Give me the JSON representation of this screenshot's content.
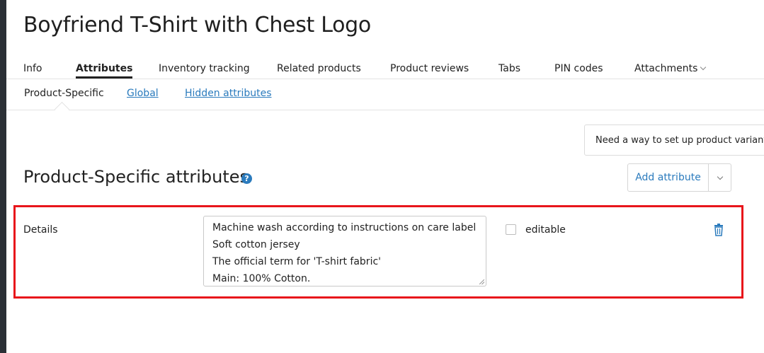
{
  "product": {
    "title": "Boyfriend T-Shirt with Chest Logo"
  },
  "tabs": [
    {
      "label": "Info"
    },
    {
      "label": "Attributes"
    },
    {
      "label": "Inventory tracking"
    },
    {
      "label": "Related products"
    },
    {
      "label": "Product reviews"
    },
    {
      "label": "Tabs"
    },
    {
      "label": "PIN codes"
    },
    {
      "label": "Attachments"
    }
  ],
  "subtabs": [
    {
      "label": "Product-Specific"
    },
    {
      "label": "Global"
    },
    {
      "label": "Hidden attributes"
    }
  ],
  "hint": {
    "text": "Need a way to set up product variants?"
  },
  "section": {
    "title": "Product-Specific attributes",
    "help_icon": "?",
    "add_button": "Add attribute"
  },
  "attribute": {
    "name": "Details",
    "value_lines": [
      "Machine wash according to instructions on care label",
      "Soft cotton jersey",
      "The official term for 'T-shirt fabric'",
      "Main: 100% Cotton."
    ],
    "editable_label": "editable",
    "editable_checked": false
  },
  "colors": {
    "link": "#2b7bbd",
    "highlight": "#e8151b",
    "sidebar": "#2b3036"
  },
  "icons": [
    "question-circle-icon",
    "chevron-down-icon",
    "trash-icon"
  ]
}
